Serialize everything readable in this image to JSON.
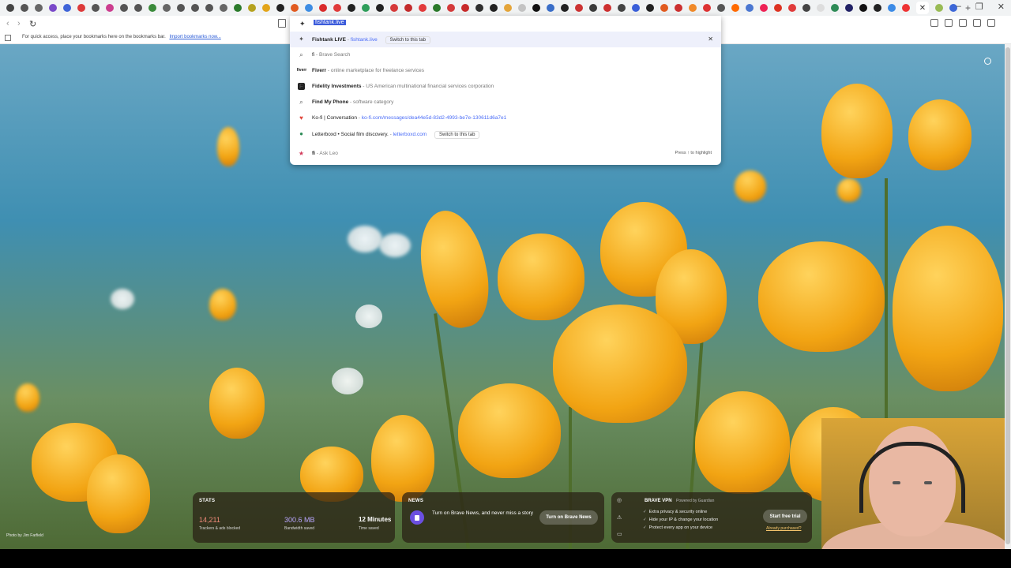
{
  "tabs": {
    "colors": [
      "#444",
      "#555",
      "#666",
      "#7a49c9",
      "#3f64d8",
      "#dd3a3a",
      "#555",
      "#cc3d8f",
      "#555",
      "#555",
      "#3b8b3b",
      "#666",
      "#555",
      "#555",
      "#555",
      "#666",
      "#2a7a2a",
      "#b5a21f",
      "#e3a51a",
      "#222",
      "#e15b20",
      "#3d8de3",
      "#d92b2b",
      "#e03b3b",
      "#222",
      "#2e9e5a",
      "#222",
      "#d63a3a",
      "#c32c2c",
      "#e23b3b",
      "#2a7a2a",
      "#d43b3b",
      "#c72a2a",
      "#2f2f2f",
      "#222",
      "#e4a53a",
      "#c3c3c3",
      "#111",
      "#3a6ec8",
      "#222",
      "#c33",
      "#3b3b3b",
      "#cd3030",
      "#444",
      "#3a5fd9",
      "#222",
      "#e15b20",
      "#cc3030",
      "#f08a2a",
      "#d33",
      "#555",
      "#ff6a00",
      "#4b77d1",
      "#e25",
      "#d32",
      "#e03b3b",
      "#444",
      "#ddd",
      "#2e8b57",
      "#226",
      "#111",
      "#222",
      "#3c8be6",
      "#e33",
      "#9b5",
      "#3d68d8"
    ],
    "active_label": "✕",
    "new_tab": "+"
  },
  "window_controls": {
    "minimize": "–",
    "restore": "❐",
    "close": "✕"
  },
  "nav": {
    "back": "‹",
    "forward": "›",
    "reload": "↻"
  },
  "bookmarks_bar": {
    "message": "For quick access, place your bookmarks here on the bookmarks bar.",
    "link": "Import bookmarks now..."
  },
  "omnibox": {
    "selected_text": "fishtank.live",
    "suggestions": [
      {
        "icon": "✦",
        "title": "Fishtank LIVE",
        "sub": " - ",
        "url": "fishtank.live",
        "switch": "Switch to this tab",
        "highlight": true
      },
      {
        "icon": "🔍",
        "title": "fi",
        "sub": " - Brave Search",
        "url": "",
        "switch": ""
      },
      {
        "icon": "fiverr",
        "title": "Fiverr",
        "sub": " - online marketplace for freelance services",
        "url": "",
        "switch": ""
      },
      {
        "icon": "F",
        "title": "Fidelity Investments",
        "sub": " - US American multinational financial services corporation",
        "url": "",
        "switch": ""
      },
      {
        "icon": "🔍",
        "title": "Find My Phone",
        "sub": " - software category",
        "url": "",
        "switch": ""
      },
      {
        "icon": "♥",
        "title": "Ko-fi | Conversation",
        "sub": " - ",
        "url": "ko-fi.com/messages/dea44e5d-83d2-4993-be7e-130611d6a7e1",
        "switch": ""
      },
      {
        "icon": "●",
        "title": "Letterboxd • Social film discovery.",
        "sub": " - ",
        "url": "letterboxd.com",
        "switch": "Switch to this tab"
      },
      {
        "icon": "★",
        "title": "fi",
        "sub": " - Ask Leo",
        "url": "",
        "switch": "",
        "hint": "Press ↑ to highlight"
      }
    ]
  },
  "page": {
    "photo_credit": "Photo by Jim Farfield",
    "customize_icon": "gear-icon"
  },
  "stats": {
    "title": "STATS",
    "trackers_value": "14,211",
    "trackers_label": "Trackers & ads blocked",
    "bandwidth_value": "300.6 MB",
    "bandwidth_label": "Bandwidth saved",
    "time_value": "12 Minutes",
    "time_label": "Time saved",
    "tracker_color": "#f08a7a",
    "bandwidth_color": "#b9a6ff"
  },
  "news": {
    "title": "NEWS",
    "text": "Turn on Brave News, and never miss a story",
    "button": "Turn on Brave News"
  },
  "vpn": {
    "title": "BRAVE VPN",
    "powered": "Powered by Guardian",
    "lines": [
      "Extra privacy & security online",
      "Hide your IP & change your location",
      "Protect every app on your device"
    ],
    "button": "Start free trial",
    "link": "Already purchased?"
  }
}
